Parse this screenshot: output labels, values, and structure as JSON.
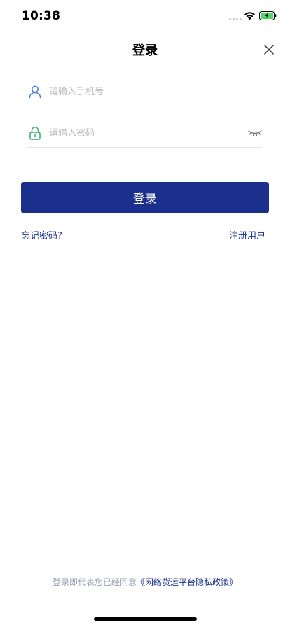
{
  "status_bar": {
    "time": "10:38"
  },
  "header": {
    "title": "登录",
    "close_icon": "close-icon"
  },
  "form": {
    "phone": {
      "placeholder": "请输入手机号",
      "value": "",
      "icon": "user-icon",
      "icon_color": "#4a7fd6"
    },
    "password": {
      "placeholder": "请输入密码",
      "value": "",
      "icon": "lock-icon",
      "icon_color": "#3aa86f",
      "toggle_icon": "eye-closed-icon"
    },
    "submit_label": "登录"
  },
  "links": {
    "forgot": "忘记密码?",
    "register": "注册用户"
  },
  "footer": {
    "agreement_text": "登录即代表您已经同意",
    "policy_link": "《网络货运平台隐私政策》"
  },
  "colors": {
    "primary": "#1b2f8d",
    "placeholder": "#b9b9b9",
    "divider": "#e4e4e4",
    "battery_charge": "#4cd964"
  }
}
